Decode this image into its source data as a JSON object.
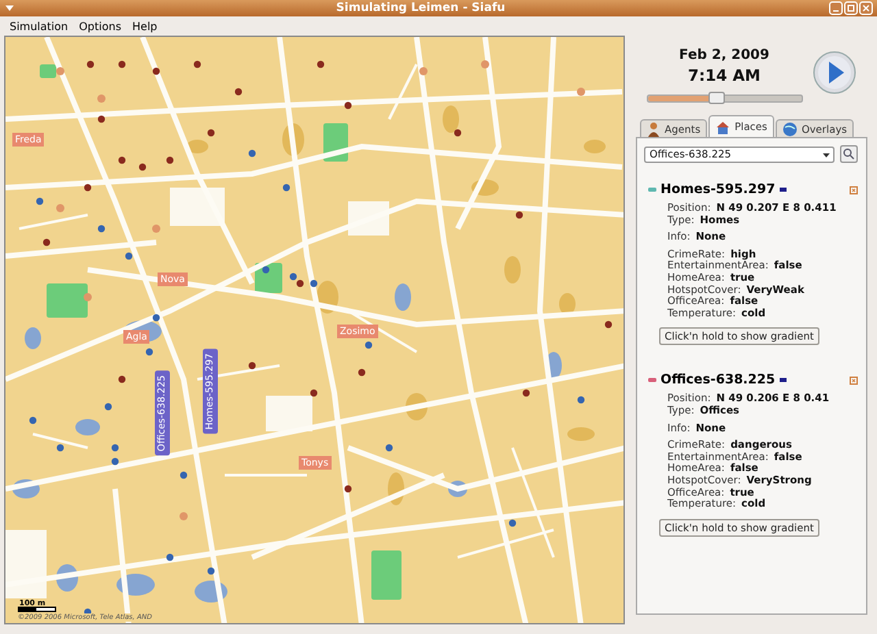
{
  "window": {
    "title": "Simulating Leimen - Siafu"
  },
  "menu": [
    "Simulation",
    "Options",
    "Help"
  ],
  "map": {
    "labels": [
      {
        "text": "Freda",
        "kind": "flat"
      },
      {
        "text": "Nova",
        "kind": "flat"
      },
      {
        "text": "Agla",
        "kind": "flat"
      },
      {
        "text": "Zosimo",
        "kind": "flat"
      },
      {
        "text": "Tonys",
        "kind": "flat"
      },
      {
        "text": "Offices-638.225",
        "kind": "vertical"
      },
      {
        "text": "Homes-595.297",
        "kind": "vertical"
      }
    ],
    "scale": "100 m",
    "attribution": "©2009 2006 Microsoft, Tele Atlas, AND"
  },
  "clock": {
    "date": "Feb 2, 2009",
    "time": "7:14 AM",
    "level": 0.45
  },
  "tabs": [
    {
      "label": "Agents",
      "selected": false
    },
    {
      "label": "Places",
      "selected": true
    },
    {
      "label": "Overlays",
      "selected": false
    }
  ],
  "place_selector": {
    "value": "Offices-638.225"
  },
  "places": [
    {
      "name": "Homes-595.297",
      "color": "#5fb8b0",
      "sections": [
        [
          [
            "Position:",
            "N 49 0.207 E 8 0.411"
          ],
          [
            "Type:",
            "Homes"
          ]
        ],
        [
          [
            "Info:",
            "None"
          ]
        ],
        [
          [
            "CrimeRate:",
            "high"
          ],
          [
            "EntertainmentArea:",
            "false"
          ],
          [
            "HomeArea:",
            "true"
          ],
          [
            "HotspotCover:",
            "VeryWeak"
          ],
          [
            "OfficeArea:",
            "false"
          ],
          [
            "Temperature:",
            "cold"
          ]
        ]
      ],
      "button": "Click'n hold to show gradient"
    },
    {
      "name": "Offices-638.225",
      "color": "#d8607a",
      "sections": [
        [
          [
            "Position:",
            "N 49 0.206 E 8 0.41"
          ],
          [
            "Type:",
            "Offices"
          ]
        ],
        [
          [
            "Info:",
            "None"
          ]
        ],
        [
          [
            "CrimeRate:",
            "dangerous"
          ],
          [
            "EntertainmentArea:",
            "false"
          ],
          [
            "HomeArea:",
            "false"
          ],
          [
            "HotspotCover:",
            "VeryStrong"
          ],
          [
            "OfficeArea:",
            "true"
          ],
          [
            "Temperature:",
            "cold"
          ]
        ]
      ],
      "button": "Click'n hold to show gradient"
    }
  ]
}
